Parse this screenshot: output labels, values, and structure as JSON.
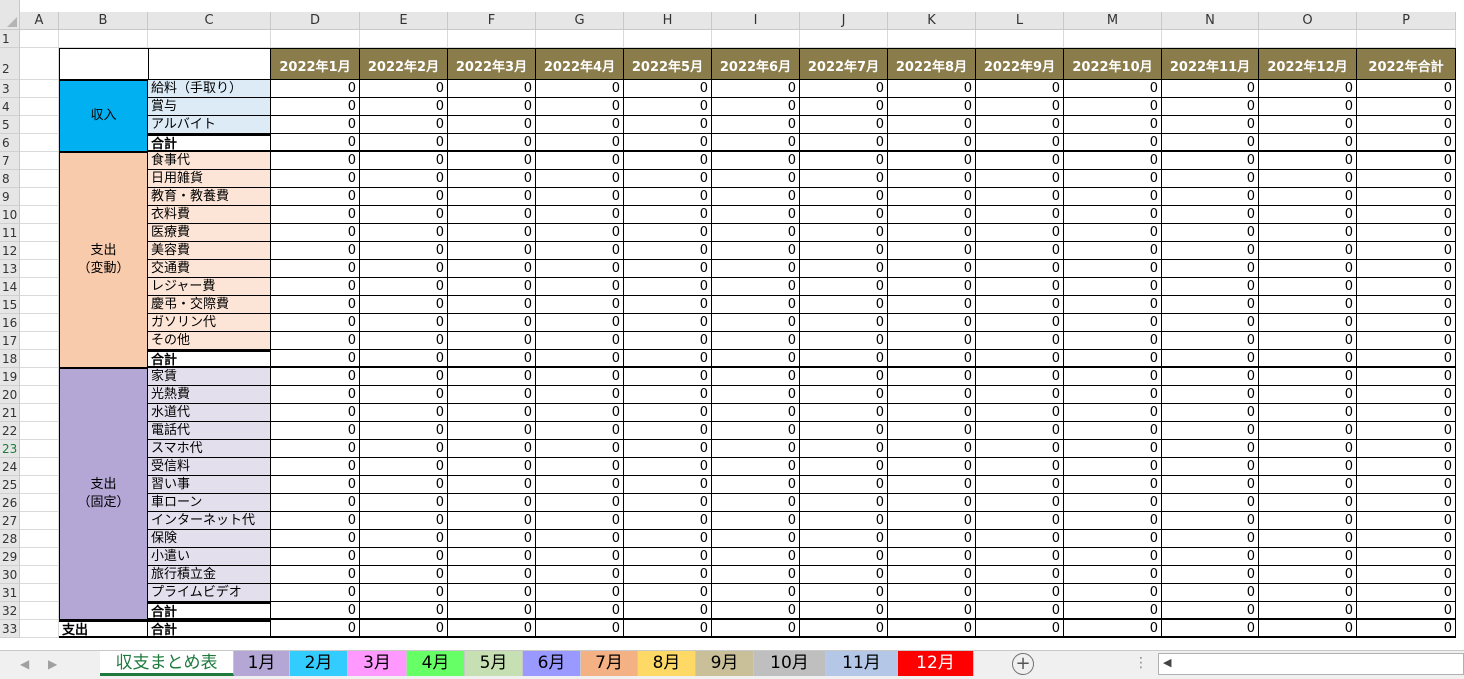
{
  "columns": [
    "A",
    "B",
    "C",
    "D",
    "E",
    "F",
    "G",
    "H",
    "I",
    "J",
    "K",
    "L",
    "M",
    "N",
    "O",
    "P"
  ],
  "row_numbers": [
    "1",
    "2",
    "3",
    "4",
    "5",
    "6",
    "7",
    "8",
    "9",
    "10",
    "11",
    "12",
    "13",
    "14",
    "15",
    "16",
    "17",
    "18",
    "19",
    "20",
    "21",
    "22",
    "23",
    "24",
    "25",
    "26",
    "27",
    "28",
    "29",
    "30",
    "31",
    "32",
    "33"
  ],
  "selected_row": "23",
  "month_headers": [
    "2022年1月",
    "2022年2月",
    "2022年3月",
    "2022年4月",
    "2022年5月",
    "2022年6月",
    "2022年7月",
    "2022年8月",
    "2022年9月",
    "2022年10月",
    "2022年11月",
    "2022年12月",
    "2022年合計"
  ],
  "groups": {
    "income": {
      "label": "収入",
      "color": "#00b0f0"
    },
    "variable": {
      "label": "支出\n（変動）",
      "color": "#f8cbad"
    },
    "fixed": {
      "label": "支出\n（固定）",
      "color": "#b4a7d6"
    }
  },
  "rows": [
    {
      "label": "給料（手取り）",
      "group": "income",
      "values": [
        "0",
        "0",
        "0",
        "0",
        "0",
        "0",
        "0",
        "0",
        "0",
        "0",
        "0",
        "0",
        "0"
      ]
    },
    {
      "label": "賞与",
      "group": "income",
      "values": [
        "0",
        "0",
        "0",
        "0",
        "0",
        "0",
        "0",
        "0",
        "0",
        "0",
        "0",
        "0",
        "0"
      ]
    },
    {
      "label": "アルバイト",
      "group": "income",
      "values": [
        "0",
        "0",
        "0",
        "0",
        "0",
        "0",
        "0",
        "0",
        "0",
        "0",
        "0",
        "0",
        "0"
      ]
    },
    {
      "label": "合計",
      "group": "income",
      "total": true,
      "values": [
        "0",
        "0",
        "0",
        "0",
        "0",
        "0",
        "0",
        "0",
        "0",
        "0",
        "0",
        "0",
        "0"
      ]
    },
    {
      "label": "食事代",
      "group": "variable",
      "values": [
        "0",
        "0",
        "0",
        "0",
        "0",
        "0",
        "0",
        "0",
        "0",
        "0",
        "0",
        "0",
        "0"
      ]
    },
    {
      "label": "日用雑貨",
      "group": "variable",
      "values": [
        "0",
        "0",
        "0",
        "0",
        "0",
        "0",
        "0",
        "0",
        "0",
        "0",
        "0",
        "0",
        "0"
      ]
    },
    {
      "label": "教育・教養費",
      "group": "variable",
      "values": [
        "0",
        "0",
        "0",
        "0",
        "0",
        "0",
        "0",
        "0",
        "0",
        "0",
        "0",
        "0",
        "0"
      ]
    },
    {
      "label": "衣料費",
      "group": "variable",
      "values": [
        "0",
        "0",
        "0",
        "0",
        "0",
        "0",
        "0",
        "0",
        "0",
        "0",
        "0",
        "0",
        "0"
      ]
    },
    {
      "label": "医療費",
      "group": "variable",
      "values": [
        "0",
        "0",
        "0",
        "0",
        "0",
        "0",
        "0",
        "0",
        "0",
        "0",
        "0",
        "0",
        "0"
      ]
    },
    {
      "label": "美容費",
      "group": "variable",
      "values": [
        "0",
        "0",
        "0",
        "0",
        "0",
        "0",
        "0",
        "0",
        "0",
        "0",
        "0",
        "0",
        "0"
      ]
    },
    {
      "label": "交通費",
      "group": "variable",
      "values": [
        "0",
        "0",
        "0",
        "0",
        "0",
        "0",
        "0",
        "0",
        "0",
        "0",
        "0",
        "0",
        "0"
      ]
    },
    {
      "label": "レジャー費",
      "group": "variable",
      "values": [
        "0",
        "0",
        "0",
        "0",
        "0",
        "0",
        "0",
        "0",
        "0",
        "0",
        "0",
        "0",
        "0"
      ]
    },
    {
      "label": "慶弔・交際費",
      "group": "variable",
      "values": [
        "0",
        "0",
        "0",
        "0",
        "0",
        "0",
        "0",
        "0",
        "0",
        "0",
        "0",
        "0",
        "0"
      ]
    },
    {
      "label": "ガソリン代",
      "group": "variable",
      "values": [
        "0",
        "0",
        "0",
        "0",
        "0",
        "0",
        "0",
        "0",
        "0",
        "0",
        "0",
        "0",
        "0"
      ]
    },
    {
      "label": "その他",
      "group": "variable",
      "values": [
        "0",
        "0",
        "0",
        "0",
        "0",
        "0",
        "0",
        "0",
        "0",
        "0",
        "0",
        "0",
        "0"
      ]
    },
    {
      "label": "合計",
      "group": "variable",
      "total": true,
      "values": [
        "0",
        "0",
        "0",
        "0",
        "0",
        "0",
        "0",
        "0",
        "0",
        "0",
        "0",
        "0",
        "0"
      ]
    },
    {
      "label": "家賃",
      "group": "fixed",
      "values": [
        "0",
        "0",
        "0",
        "0",
        "0",
        "0",
        "0",
        "0",
        "0",
        "0",
        "0",
        "0",
        "0"
      ]
    },
    {
      "label": "光熱費",
      "group": "fixed",
      "values": [
        "0",
        "0",
        "0",
        "0",
        "0",
        "0",
        "0",
        "0",
        "0",
        "0",
        "0",
        "0",
        "0"
      ]
    },
    {
      "label": "水道代",
      "group": "fixed",
      "values": [
        "0",
        "0",
        "0",
        "0",
        "0",
        "0",
        "0",
        "0",
        "0",
        "0",
        "0",
        "0",
        "0"
      ]
    },
    {
      "label": "電話代",
      "group": "fixed",
      "values": [
        "0",
        "0",
        "0",
        "0",
        "0",
        "0",
        "0",
        "0",
        "0",
        "0",
        "0",
        "0",
        "0"
      ]
    },
    {
      "label": "スマホ代",
      "group": "fixed",
      "values": [
        "0",
        "0",
        "0",
        "0",
        "0",
        "0",
        "0",
        "0",
        "0",
        "0",
        "0",
        "0",
        "0"
      ]
    },
    {
      "label": "受信料",
      "group": "fixed",
      "values": [
        "0",
        "0",
        "0",
        "0",
        "0",
        "0",
        "0",
        "0",
        "0",
        "0",
        "0",
        "0",
        "0"
      ]
    },
    {
      "label": "習い事",
      "group": "fixed",
      "values": [
        "0",
        "0",
        "0",
        "0",
        "0",
        "0",
        "0",
        "0",
        "0",
        "0",
        "0",
        "0",
        "0"
      ]
    },
    {
      "label": "車ローン",
      "group": "fixed",
      "values": [
        "0",
        "0",
        "0",
        "0",
        "0",
        "0",
        "0",
        "0",
        "0",
        "0",
        "0",
        "0",
        "0"
      ]
    },
    {
      "label": "インターネット代",
      "group": "fixed",
      "values": [
        "0",
        "0",
        "0",
        "0",
        "0",
        "0",
        "0",
        "0",
        "0",
        "0",
        "0",
        "0",
        "0"
      ]
    },
    {
      "label": "保険",
      "group": "fixed",
      "values": [
        "0",
        "0",
        "0",
        "0",
        "0",
        "0",
        "0",
        "0",
        "0",
        "0",
        "0",
        "0",
        "0"
      ]
    },
    {
      "label": "小遣い",
      "group": "fixed",
      "values": [
        "0",
        "0",
        "0",
        "0",
        "0",
        "0",
        "0",
        "0",
        "0",
        "0",
        "0",
        "0",
        "0"
      ]
    },
    {
      "label": "旅行積立金",
      "group": "fixed",
      "values": [
        "0",
        "0",
        "0",
        "0",
        "0",
        "0",
        "0",
        "0",
        "0",
        "0",
        "0",
        "0",
        "0"
      ]
    },
    {
      "label": "プライムビデオ",
      "group": "fixed",
      "values": [
        "0",
        "0",
        "0",
        "0",
        "0",
        "0",
        "0",
        "0",
        "0",
        "0",
        "0",
        "0",
        "0"
      ]
    },
    {
      "label": "合計",
      "group": "fixed",
      "total": true,
      "values": [
        "0",
        "0",
        "0",
        "0",
        "0",
        "0",
        "0",
        "0",
        "0",
        "0",
        "0",
        "0",
        "0"
      ]
    },
    {
      "label": "合計",
      "group": "expense",
      "group_label": "支出",
      "total": true,
      "values": [
        "0",
        "0",
        "0",
        "0",
        "0",
        "0",
        "0",
        "0",
        "0",
        "0",
        "0",
        "0",
        "0"
      ]
    }
  ],
  "sheet_tabs": [
    {
      "label": "収支まとめ表",
      "color": "#ffffff",
      "active": true
    },
    {
      "label": "1月",
      "color": "#b4a7d6"
    },
    {
      "label": "2月",
      "color": "#33ccff"
    },
    {
      "label": "3月",
      "color": "#ff99ff"
    },
    {
      "label": "4月",
      "color": "#66ff66"
    },
    {
      "label": "5月",
      "color": "#c6e0b4"
    },
    {
      "label": "6月",
      "color": "#9999ff"
    },
    {
      "label": "7月",
      "color": "#f4b183"
    },
    {
      "label": "8月",
      "color": "#ffd966"
    },
    {
      "label": "9月",
      "color": "#c9c09a"
    },
    {
      "label": "10月",
      "color": "#bfbfbf"
    },
    {
      "label": "11月",
      "color": "#b4c7e7"
    },
    {
      "label": "12月",
      "color": "#ff0000"
    }
  ],
  "icons": {
    "prev_sheet": "triangle-left-icon",
    "next_sheet": "triangle-right-icon",
    "add_sheet": "plus-circle-icon",
    "more": "vertical-dots-icon",
    "scroll_left": "triangle-left-icon"
  },
  "label_bg": {
    "income": "#ddebf7",
    "variable": "#fce4d6",
    "fixed": "#e4dfec"
  },
  "header_color": "#8b7d4b"
}
